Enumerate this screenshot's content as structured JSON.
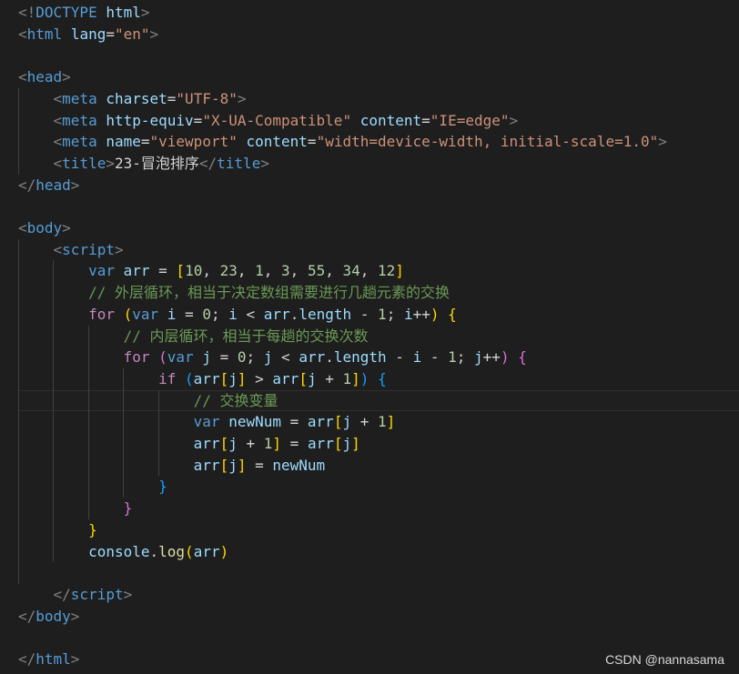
{
  "editor": {
    "lines": [
      [
        [
          "punct",
          "<!"
        ],
        [
          "tag",
          "DOCTYPE"
        ],
        [
          "text",
          " "
        ],
        [
          "attr",
          "html"
        ],
        [
          "punct",
          ">"
        ]
      ],
      [
        [
          "punct",
          "<"
        ],
        [
          "tag",
          "html"
        ],
        [
          "text",
          " "
        ],
        [
          "attr",
          "lang"
        ],
        [
          "op",
          "="
        ],
        [
          "str",
          "\"en\""
        ],
        [
          "punct",
          ">"
        ]
      ],
      [],
      [
        [
          "punct",
          "<"
        ],
        [
          "tag",
          "head"
        ],
        [
          "punct",
          ">"
        ]
      ],
      [
        [
          "text",
          "    "
        ],
        [
          "punct",
          "<"
        ],
        [
          "tag",
          "meta"
        ],
        [
          "text",
          " "
        ],
        [
          "attr",
          "charset"
        ],
        [
          "op",
          "="
        ],
        [
          "str",
          "\"UTF-8\""
        ],
        [
          "punct",
          ">"
        ]
      ],
      [
        [
          "text",
          "    "
        ],
        [
          "punct",
          "<"
        ],
        [
          "tag",
          "meta"
        ],
        [
          "text",
          " "
        ],
        [
          "attr",
          "http-equiv"
        ],
        [
          "op",
          "="
        ],
        [
          "str",
          "\"X-UA-Compatible\""
        ],
        [
          "text",
          " "
        ],
        [
          "attr",
          "content"
        ],
        [
          "op",
          "="
        ],
        [
          "str",
          "\"IE=edge\""
        ],
        [
          "punct",
          ">"
        ]
      ],
      [
        [
          "text",
          "    "
        ],
        [
          "punct",
          "<"
        ],
        [
          "tag",
          "meta"
        ],
        [
          "text",
          " "
        ],
        [
          "attr",
          "name"
        ],
        [
          "op",
          "="
        ],
        [
          "str",
          "\"viewport\""
        ],
        [
          "text",
          " "
        ],
        [
          "attr",
          "content"
        ],
        [
          "op",
          "="
        ],
        [
          "str",
          "\"width=device-width, initial-scale=1.0\""
        ],
        [
          "punct",
          ">"
        ]
      ],
      [
        [
          "text",
          "    "
        ],
        [
          "punct",
          "<"
        ],
        [
          "tag",
          "title"
        ],
        [
          "punct",
          ">"
        ],
        [
          "text",
          "23-冒泡排序"
        ],
        [
          "punct",
          "</"
        ],
        [
          "tag",
          "title"
        ],
        [
          "punct",
          ">"
        ]
      ],
      [
        [
          "punct",
          "</"
        ],
        [
          "tag",
          "head"
        ],
        [
          "punct",
          ">"
        ]
      ],
      [],
      [
        [
          "punct",
          "<"
        ],
        [
          "tag",
          "body"
        ],
        [
          "punct",
          ">"
        ]
      ],
      [
        [
          "text",
          "    "
        ],
        [
          "punct",
          "<"
        ],
        [
          "tag",
          "script"
        ],
        [
          "punct",
          ">"
        ]
      ],
      [
        [
          "text",
          "        "
        ],
        [
          "kw",
          "var"
        ],
        [
          "text",
          " "
        ],
        [
          "var",
          "arr"
        ],
        [
          "op",
          " = "
        ],
        [
          "b1",
          "["
        ],
        [
          "num",
          "10"
        ],
        [
          "op",
          ", "
        ],
        [
          "num",
          "23"
        ],
        [
          "op",
          ", "
        ],
        [
          "num",
          "1"
        ],
        [
          "op",
          ", "
        ],
        [
          "num",
          "3"
        ],
        [
          "op",
          ", "
        ],
        [
          "num",
          "55"
        ],
        [
          "op",
          ", "
        ],
        [
          "num",
          "34"
        ],
        [
          "op",
          ", "
        ],
        [
          "num",
          "12"
        ],
        [
          "b1",
          "]"
        ]
      ],
      [
        [
          "text",
          "        "
        ],
        [
          "comment",
          "// 外层循环，相当于决定数组需要进行几趟元素的交换"
        ]
      ],
      [
        [
          "text",
          "        "
        ],
        [
          "ctrl",
          "for"
        ],
        [
          "text",
          " "
        ],
        [
          "b1",
          "("
        ],
        [
          "kw",
          "var"
        ],
        [
          "text",
          " "
        ],
        [
          "var",
          "i"
        ],
        [
          "op",
          " = "
        ],
        [
          "num",
          "0"
        ],
        [
          "op",
          "; "
        ],
        [
          "var",
          "i"
        ],
        [
          "op",
          " < "
        ],
        [
          "var",
          "arr"
        ],
        [
          "op",
          "."
        ],
        [
          "var",
          "length"
        ],
        [
          "op",
          " - "
        ],
        [
          "num",
          "1"
        ],
        [
          "op",
          "; "
        ],
        [
          "var",
          "i"
        ],
        [
          "op",
          "++"
        ],
        [
          "b1",
          ")"
        ],
        [
          "text",
          " "
        ],
        [
          "b1",
          "{"
        ]
      ],
      [
        [
          "text",
          "            "
        ],
        [
          "comment",
          "// 内层循环，相当于每趟的交换次数"
        ]
      ],
      [
        [
          "text",
          "            "
        ],
        [
          "ctrl",
          "for"
        ],
        [
          "text",
          " "
        ],
        [
          "b2",
          "("
        ],
        [
          "kw",
          "var"
        ],
        [
          "text",
          " "
        ],
        [
          "var",
          "j"
        ],
        [
          "op",
          " = "
        ],
        [
          "num",
          "0"
        ],
        [
          "op",
          "; "
        ],
        [
          "var",
          "j"
        ],
        [
          "op",
          " < "
        ],
        [
          "var",
          "arr"
        ],
        [
          "op",
          "."
        ],
        [
          "var",
          "length"
        ],
        [
          "op",
          " - "
        ],
        [
          "var",
          "i"
        ],
        [
          "op",
          " - "
        ],
        [
          "num",
          "1"
        ],
        [
          "op",
          "; "
        ],
        [
          "var",
          "j"
        ],
        [
          "op",
          "++"
        ],
        [
          "b2",
          ")"
        ],
        [
          "text",
          " "
        ],
        [
          "b2",
          "{"
        ]
      ],
      [
        [
          "text",
          "                "
        ],
        [
          "ctrl",
          "if"
        ],
        [
          "text",
          " "
        ],
        [
          "b3",
          "("
        ],
        [
          "var",
          "arr"
        ],
        [
          "b1",
          "["
        ],
        [
          "var",
          "j"
        ],
        [
          "b1",
          "]"
        ],
        [
          "op",
          " > "
        ],
        [
          "var",
          "arr"
        ],
        [
          "b1",
          "["
        ],
        [
          "var",
          "j"
        ],
        [
          "op",
          " + "
        ],
        [
          "num",
          "1"
        ],
        [
          "b1",
          "]"
        ],
        [
          "b3",
          ")"
        ],
        [
          "text",
          " "
        ],
        [
          "b3",
          "{"
        ]
      ],
      [
        [
          "text",
          "                    "
        ],
        [
          "comment",
          "// 交换变量"
        ]
      ],
      [
        [
          "text",
          "                    "
        ],
        [
          "kw",
          "var"
        ],
        [
          "text",
          " "
        ],
        [
          "var",
          "newNum"
        ],
        [
          "op",
          " = "
        ],
        [
          "var",
          "arr"
        ],
        [
          "b1",
          "["
        ],
        [
          "var",
          "j"
        ],
        [
          "op",
          " + "
        ],
        [
          "num",
          "1"
        ],
        [
          "b1",
          "]"
        ]
      ],
      [
        [
          "text",
          "                    "
        ],
        [
          "var",
          "arr"
        ],
        [
          "b1",
          "["
        ],
        [
          "var",
          "j"
        ],
        [
          "op",
          " + "
        ],
        [
          "num",
          "1"
        ],
        [
          "b1",
          "]"
        ],
        [
          "op",
          " = "
        ],
        [
          "var",
          "arr"
        ],
        [
          "b1",
          "["
        ],
        [
          "var",
          "j"
        ],
        [
          "b1",
          "]"
        ]
      ],
      [
        [
          "text",
          "                    "
        ],
        [
          "var",
          "arr"
        ],
        [
          "b1",
          "["
        ],
        [
          "var",
          "j"
        ],
        [
          "b1",
          "]"
        ],
        [
          "op",
          " = "
        ],
        [
          "var",
          "newNum"
        ]
      ],
      [
        [
          "text",
          "                "
        ],
        [
          "b3",
          "}"
        ]
      ],
      [
        [
          "text",
          "            "
        ],
        [
          "b2",
          "}"
        ]
      ],
      [
        [
          "text",
          "        "
        ],
        [
          "b1",
          "}"
        ]
      ],
      [
        [
          "text",
          "        "
        ],
        [
          "var",
          "console"
        ],
        [
          "op",
          "."
        ],
        [
          "fn",
          "log"
        ],
        [
          "b1",
          "("
        ],
        [
          "var",
          "arr"
        ],
        [
          "b1",
          ")"
        ]
      ],
      [],
      [
        [
          "text",
          "    "
        ],
        [
          "punct",
          "</"
        ],
        [
          "tag",
          "script"
        ],
        [
          "punct",
          ">"
        ]
      ],
      [
        [
          "punct",
          "</"
        ],
        [
          "tag",
          "body"
        ],
        [
          "punct",
          ">"
        ]
      ],
      [],
      [
        [
          "punct",
          "</"
        ],
        [
          "tag",
          "html"
        ],
        [
          "punct",
          ">"
        ]
      ]
    ]
  },
  "watermark": {
    "text": "CSDN @nannasama"
  },
  "colors": {
    "background": "#1e1e1e",
    "punct": "#808080",
    "tag": "#569cd6",
    "attr": "#9cdcfe",
    "string": "#ce9178",
    "keyword": "#569cd6",
    "control": "#c586c0",
    "number": "#b5cea8",
    "comment": "#6a9955",
    "function": "#dcdcaa",
    "bracket_1": "#ffd700",
    "bracket_2": "#da70d6",
    "bracket_3": "#179fff"
  }
}
